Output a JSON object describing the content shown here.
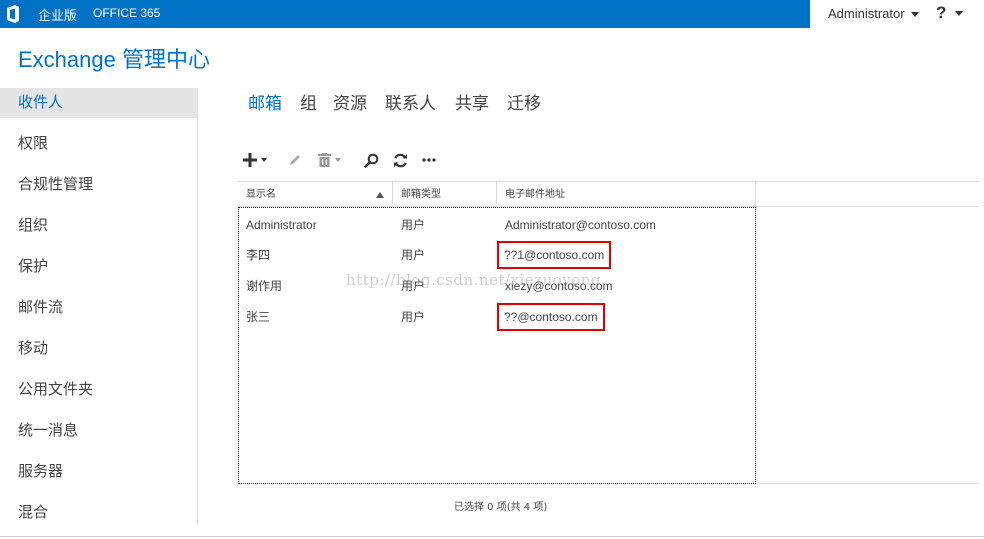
{
  "topbar": {
    "brand_primary": "企业版",
    "brand_secondary": "OFFICE 365",
    "user_name": "Administrator",
    "help_label": "?",
    "logo_icon": "office-logo-icon",
    "accent": "#0072c6"
  },
  "app_title": "Exchange 管理中心",
  "nav": {
    "items": [
      {
        "label": "收件人",
        "active": true
      },
      {
        "label": "权限"
      },
      {
        "label": "合规性管理"
      },
      {
        "label": "组织"
      },
      {
        "label": "保护"
      },
      {
        "label": "邮件流"
      },
      {
        "label": "移动"
      },
      {
        "label": "公用文件夹"
      },
      {
        "label": "统一消息"
      },
      {
        "label": "服务器"
      },
      {
        "label": "混合"
      }
    ]
  },
  "tabs": [
    {
      "label": "邮箱",
      "active": true
    },
    {
      "label": "组"
    },
    {
      "label": "资源"
    },
    {
      "label": "联系人"
    },
    {
      "label": "共享"
    },
    {
      "label": "迁移"
    }
  ],
  "toolbar": {
    "icons": [
      "add-icon",
      "edit-icon",
      "delete-icon",
      "search-icon",
      "refresh-icon",
      "more-icon"
    ]
  },
  "table": {
    "columns": [
      "显示名",
      "邮箱类型",
      "电子邮件地址"
    ],
    "sort_column": "显示名",
    "rows": [
      {
        "name": "Administrator",
        "type": "用户",
        "email": "Administrator@contoso.com",
        "highlighted": false
      },
      {
        "name": "李四",
        "type": "用户",
        "email": "??1@contoso.com",
        "highlighted": true
      },
      {
        "name": "谢作用",
        "type": "用户",
        "email": "xiezy@contoso.com",
        "highlighted": false
      },
      {
        "name": "张三",
        "type": "用户",
        "email": "??@contoso.com",
        "highlighted": true
      }
    ]
  },
  "watermark": "http://blog.csdn.net/xiezuoyong",
  "status_text": "已选择 0 项(共 4 项)",
  "highlight_color": "#e00000"
}
